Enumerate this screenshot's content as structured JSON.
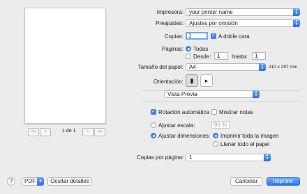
{
  "preview": {
    "first_label": "<<",
    "prev_label": "<",
    "page_indicator": "1 de 1",
    "next_label": ">",
    "last_label": ">>"
  },
  "printer": {
    "label": "Impresora:",
    "value": "your printer name"
  },
  "presets": {
    "label": "Preajustes:",
    "value": "Ajustes por omisión"
  },
  "copies": {
    "label": "Copias:",
    "value": "1",
    "double_sided_label": "A doble cara",
    "double_sided_checked": true
  },
  "pages": {
    "label": "Páginas:",
    "all_label": "Todas",
    "from_label": "Desde:",
    "from_value": "1",
    "to_label": "hasta:",
    "to_value": "1"
  },
  "paper_size": {
    "label": "Tamaño del papel:",
    "value": "A4",
    "dimensions": "210 x 297 mm"
  },
  "orientation": {
    "label": "Orientación:",
    "portrait_icon": "portrait-icon",
    "landscape_icon": "landscape-icon"
  },
  "section": {
    "value": "Vista Previa"
  },
  "auto_rotate": {
    "label": "Rotación automática",
    "checked": true
  },
  "show_notes": {
    "label": "Mostrar notas",
    "checked": false
  },
  "scale": {
    "label": "Ajustar escala:",
    "value": "96 %"
  },
  "fit": {
    "label": "Ajustar dimensiones:",
    "print_entire_label": "Imprimir toda la imagen",
    "fill_paper_label": "Llenar todo el papel"
  },
  "copies_per_page": {
    "label": "Copias por página:",
    "value": "1"
  },
  "footer": {
    "help_label": "?",
    "pdf_label": "PDF",
    "hide_details_label": "Ocultar detalles",
    "cancel_label": "Cancelar",
    "print_label": "Imprimir"
  },
  "colors": {
    "accent": "#3b82f6"
  }
}
